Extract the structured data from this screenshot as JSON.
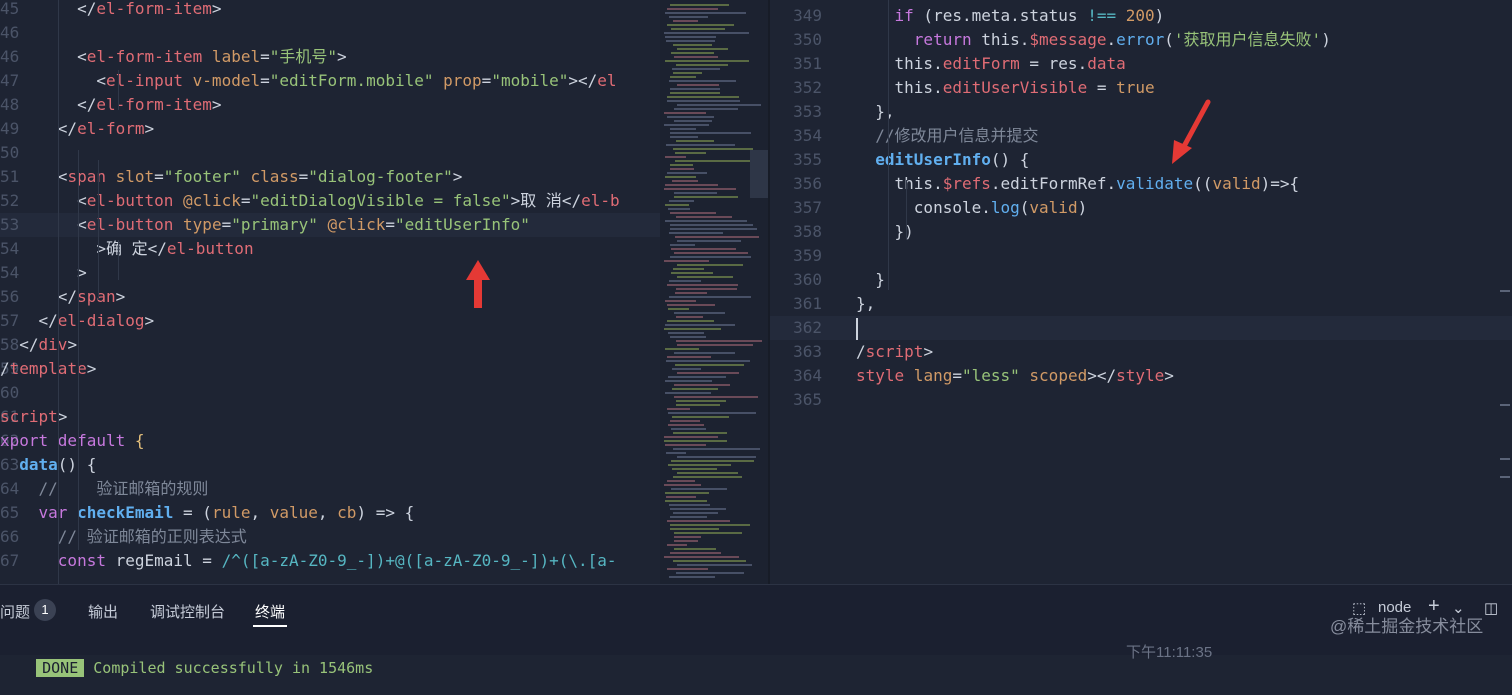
{
  "editor_left": {
    "lines": [
      {
        "ln": "45",
        "segments": [
          {
            "t": "        </",
            "c": "p"
          },
          {
            "t": "el-form-item",
            "c": "t"
          },
          {
            "t": ">",
            "c": "p"
          }
        ]
      },
      {
        "ln": "46",
        "segments": []
      },
      {
        "ln": "46",
        "segments": [
          {
            "t": "        <",
            "c": "p"
          },
          {
            "t": "el-form-item",
            "c": "t"
          },
          {
            "t": " label",
            "c": "a"
          },
          {
            "t": "=",
            "c": "p"
          },
          {
            "t": "\"手机号\"",
            "c": "s"
          },
          {
            "t": ">",
            "c": "p"
          }
        ]
      },
      {
        "ln": "47",
        "segments": [
          {
            "t": "          <",
            "c": "p"
          },
          {
            "t": "el-input",
            "c": "t"
          },
          {
            "t": " v-model",
            "c": "a"
          },
          {
            "t": "=",
            "c": "p"
          },
          {
            "t": "\"editForm.mobile\"",
            "c": "s"
          },
          {
            "t": " prop",
            "c": "a"
          },
          {
            "t": "=",
            "c": "p"
          },
          {
            "t": "\"mobile\"",
            "c": "s"
          },
          {
            "t": "></",
            "c": "p"
          },
          {
            "t": "el",
            "c": "t"
          }
        ]
      },
      {
        "ln": "48",
        "segments": [
          {
            "t": "        </",
            "c": "p"
          },
          {
            "t": "el-form-item",
            "c": "t"
          },
          {
            "t": ">",
            "c": "p"
          }
        ]
      },
      {
        "ln": "49",
        "segments": [
          {
            "t": "      </",
            "c": "p"
          },
          {
            "t": "el-form",
            "c": "t"
          },
          {
            "t": ">",
            "c": "p"
          }
        ]
      },
      {
        "ln": "50",
        "segments": []
      },
      {
        "ln": "51",
        "segments": [
          {
            "t": "      <",
            "c": "p"
          },
          {
            "t": "span",
            "c": "t"
          },
          {
            "t": " slot",
            "c": "a"
          },
          {
            "t": "=",
            "c": "p"
          },
          {
            "t": "\"footer\"",
            "c": "s"
          },
          {
            "t": " class",
            "c": "a"
          },
          {
            "t": "=",
            "c": "p"
          },
          {
            "t": "\"dialog-footer\"",
            "c": "s"
          },
          {
            "t": ">",
            "c": "p"
          }
        ]
      },
      {
        "ln": "52",
        "segments": [
          {
            "t": "        <",
            "c": "p"
          },
          {
            "t": "el-button",
            "c": "t"
          },
          {
            "t": " @click",
            "c": "a"
          },
          {
            "t": "=",
            "c": "p"
          },
          {
            "t": "\"editDialogVisible = false\"",
            "c": "s"
          },
          {
            "t": ">取 消</",
            "c": "p"
          },
          {
            "t": "el-b",
            "c": "t"
          }
        ]
      },
      {
        "ln": "53",
        "segments": [
          {
            "t": "        <",
            "c": "p"
          },
          {
            "t": "el-button",
            "c": "t"
          },
          {
            "t": " type",
            "c": "a"
          },
          {
            "t": "=",
            "c": "p"
          },
          {
            "t": "\"primary\"",
            "c": "s"
          },
          {
            "t": " @click",
            "c": "a"
          },
          {
            "t": "=",
            "c": "p"
          },
          {
            "t": "\"editUserInfo\"",
            "c": "s"
          }
        ]
      },
      {
        "ln": "54",
        "segments": [
          {
            "t": "          >确 定</",
            "c": "p"
          },
          {
            "t": "el-button",
            "c": "t"
          }
        ]
      },
      {
        "ln": "54",
        "segments": [
          {
            "t": "        >",
            "c": "p"
          }
        ]
      },
      {
        "ln": "56",
        "segments": [
          {
            "t": "      </",
            "c": "p"
          },
          {
            "t": "span",
            "c": "t"
          },
          {
            "t": ">",
            "c": "p"
          }
        ]
      },
      {
        "ln": "57",
        "segments": [
          {
            "t": "    </",
            "c": "p"
          },
          {
            "t": "el-dialog",
            "c": "t"
          },
          {
            "t": ">",
            "c": "p"
          }
        ]
      },
      {
        "ln": "58",
        "segments": [
          {
            "t": "  </",
            "c": "p"
          },
          {
            "t": "div",
            "c": "t"
          },
          {
            "t": ">",
            "c": "p"
          }
        ]
      },
      {
        "ln": "59",
        "segments": [
          {
            "t": "/",
            "c": "p"
          },
          {
            "t": "template",
            "c": "t"
          },
          {
            "t": ">",
            "c": "p"
          }
        ]
      },
      {
        "ln": "60",
        "segments": []
      },
      {
        "ln": "61",
        "segments": [
          {
            "t": "script",
            "c": "t"
          },
          {
            "t": ">",
            "c": "p"
          }
        ]
      },
      {
        "ln": "62",
        "segments": [
          {
            "t": "xport default",
            "c": "k"
          },
          {
            "t": " {",
            "c": "y"
          }
        ]
      },
      {
        "ln": "63",
        "segments": [
          {
            "t": "  ",
            "c": "p"
          },
          {
            "t": "data",
            "c": "fb"
          },
          {
            "t": "() {",
            "c": "p"
          }
        ]
      },
      {
        "ln": "64",
        "segments": [
          {
            "t": "    //    验证邮箱的规则",
            "c": "c"
          }
        ]
      },
      {
        "ln": "65",
        "segments": [
          {
            "t": "    ",
            "c": "p"
          },
          {
            "t": "var",
            "c": "k"
          },
          {
            "t": " ",
            "c": "p"
          },
          {
            "t": "checkEmail",
            "c": "fb"
          },
          {
            "t": " = (",
            "c": "p"
          },
          {
            "t": "rule",
            "c": "a"
          },
          {
            "t": ", ",
            "c": "p"
          },
          {
            "t": "value",
            "c": "a"
          },
          {
            "t": ", ",
            "c": "p"
          },
          {
            "t": "cb",
            "c": "a"
          },
          {
            "t": ") => {",
            "c": "p"
          }
        ]
      },
      {
        "ln": "66",
        "segments": [
          {
            "t": "      // 验证邮箱的正则表达式",
            "c": "c"
          }
        ]
      },
      {
        "ln": "67",
        "segments": [
          {
            "t": "      ",
            "c": "p"
          },
          {
            "t": "const",
            "c": "k"
          },
          {
            "t": " regEmail = ",
            "c": "p"
          },
          {
            "t": "/^([a-zA-Z0-9_-])+@([a-zA-Z0-9_-])+(\\.[a-",
            "c": "b"
          }
        ]
      }
    ]
  },
  "editor_right": {
    "lines": [
      {
        "ln": "349",
        "segments": [
          {
            "t": "    ",
            "c": "p"
          },
          {
            "t": "if",
            "c": "k"
          },
          {
            "t": " (res.meta.status ",
            "c": "p"
          },
          {
            "t": "!==",
            "c": "b"
          },
          {
            "t": " ",
            "c": "p"
          },
          {
            "t": "200",
            "c": "n"
          },
          {
            "t": ")",
            "c": "p"
          }
        ]
      },
      {
        "ln": "350",
        "segments": [
          {
            "t": "      ",
            "c": "p"
          },
          {
            "t": "return",
            "c": "k"
          },
          {
            "t": " this.",
            "c": "p"
          },
          {
            "t": "$message",
            "c": "t"
          },
          {
            "t": ".",
            "c": "p"
          },
          {
            "t": "error",
            "c": "f"
          },
          {
            "t": "(",
            "c": "p"
          },
          {
            "t": "'获取用户信息失败'",
            "c": "s"
          },
          {
            "t": ")",
            "c": "p"
          }
        ]
      },
      {
        "ln": "351",
        "segments": [
          {
            "t": "    ",
            "c": "p"
          },
          {
            "t": "this",
            "c": "p"
          },
          {
            "t": ".",
            "c": "p"
          },
          {
            "t": "editForm",
            "c": "t"
          },
          {
            "t": " = res.",
            "c": "p"
          },
          {
            "t": "data",
            "c": "t"
          }
        ]
      },
      {
        "ln": "352",
        "segments": [
          {
            "t": "    ",
            "c": "p"
          },
          {
            "t": "this",
            "c": "p"
          },
          {
            "t": ".",
            "c": "p"
          },
          {
            "t": "editUserVisible",
            "c": "t"
          },
          {
            "t": " = ",
            "c": "p"
          },
          {
            "t": "true",
            "c": "n"
          }
        ]
      },
      {
        "ln": "353",
        "segments": [
          {
            "t": "  },",
            "c": "p"
          }
        ]
      },
      {
        "ln": "354",
        "segments": [
          {
            "t": "  //修改用户信息并提交",
            "c": "c"
          }
        ]
      },
      {
        "ln": "355",
        "segments": [
          {
            "t": "  ",
            "c": "p"
          },
          {
            "t": "editUserInfo",
            "c": "fb"
          },
          {
            "t": "() {",
            "c": "p"
          }
        ]
      },
      {
        "ln": "356",
        "segments": [
          {
            "t": "    this.",
            "c": "p"
          },
          {
            "t": "$refs",
            "c": "t"
          },
          {
            "t": ".editFormRef.",
            "c": "p"
          },
          {
            "t": "validate",
            "c": "f"
          },
          {
            "t": "((",
            "c": "p"
          },
          {
            "t": "valid",
            "c": "a"
          },
          {
            "t": ")=>{",
            "c": "p"
          }
        ]
      },
      {
        "ln": "357",
        "segments": [
          {
            "t": "      console.",
            "c": "p"
          },
          {
            "t": "log",
            "c": "f"
          },
          {
            "t": "(",
            "c": "p"
          },
          {
            "t": "valid",
            "c": "a"
          },
          {
            "t": ")",
            "c": "p"
          }
        ]
      },
      {
        "ln": "358",
        "segments": [
          {
            "t": "    })",
            "c": "p"
          }
        ]
      },
      {
        "ln": "359",
        "segments": []
      },
      {
        "ln": "360",
        "segments": [
          {
            "t": "  }",
            "c": "p"
          }
        ]
      },
      {
        "ln": "361",
        "segments": [
          {
            "t": "},",
            "c": "p"
          }
        ]
      },
      {
        "ln": "362",
        "segments": []
      },
      {
        "ln": "363",
        "segments": [
          {
            "t": "/",
            "c": "p"
          },
          {
            "t": "script",
            "c": "t"
          },
          {
            "t": ">",
            "c": "p"
          }
        ]
      },
      {
        "ln": "364",
        "segments": [
          {
            "t": "style",
            "c": "t"
          },
          {
            "t": " lang",
            "c": "a"
          },
          {
            "t": "=",
            "c": "p"
          },
          {
            "t": "\"less\"",
            "c": "s"
          },
          {
            "t": " scoped",
            "c": "a"
          },
          {
            "t": "></",
            "c": "p"
          },
          {
            "t": "style",
            "c": "t"
          },
          {
            "t": ">",
            "c": "p"
          }
        ]
      },
      {
        "ln": "365",
        "segments": []
      }
    ]
  },
  "panel": {
    "tabs": [
      "问题",
      "输出",
      "调试控制台",
      "终端"
    ],
    "problems_count": "1",
    "active_tab": "终端",
    "terminal_profile": "node",
    "terminal_badge": "DONE",
    "terminal_message": " Compiled successfully in 1546ms",
    "timestamp": "下午11:11:35"
  },
  "watermark": "@稀土掘金技术社区",
  "colors": {
    "annotation_arrow": "#e53935",
    "accent": "#61afef"
  }
}
